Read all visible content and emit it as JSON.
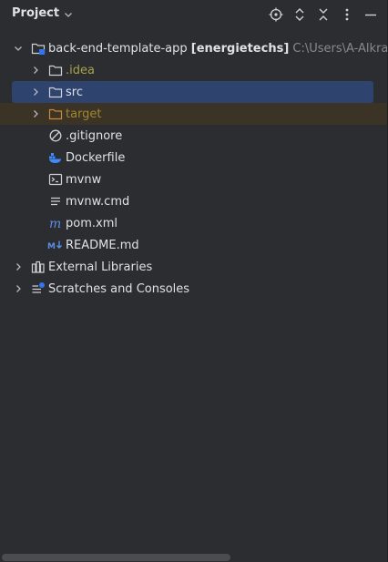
{
  "header": {
    "title": "Project",
    "toolbar": [
      "locate-icon",
      "expand-collapse-icon",
      "collapse-all-icon",
      "more-icon",
      "minimize-icon"
    ]
  },
  "tree": {
    "root": {
      "name": "back-end-template-app",
      "module": "[energietechs]",
      "path": "C:\\Users\\A-Alkraie"
    },
    "items": [
      {
        "label": ".idea"
      },
      {
        "label": "src"
      },
      {
        "label": "target"
      },
      {
        "label": ".gitignore"
      },
      {
        "label": "Dockerfile"
      },
      {
        "label": "mvnw"
      },
      {
        "label": "mvnw.cmd"
      },
      {
        "label": "pom.xml"
      },
      {
        "label": "README.md"
      },
      {
        "label": "External Libraries"
      },
      {
        "label": "Scratches and Consoles"
      }
    ]
  },
  "colors": {
    "background": "#2b2d30",
    "selection": "#2e436e",
    "excluded": "#3a3326",
    "idea_folder": "#a9a24a",
    "target_folder": "#a3872f"
  }
}
